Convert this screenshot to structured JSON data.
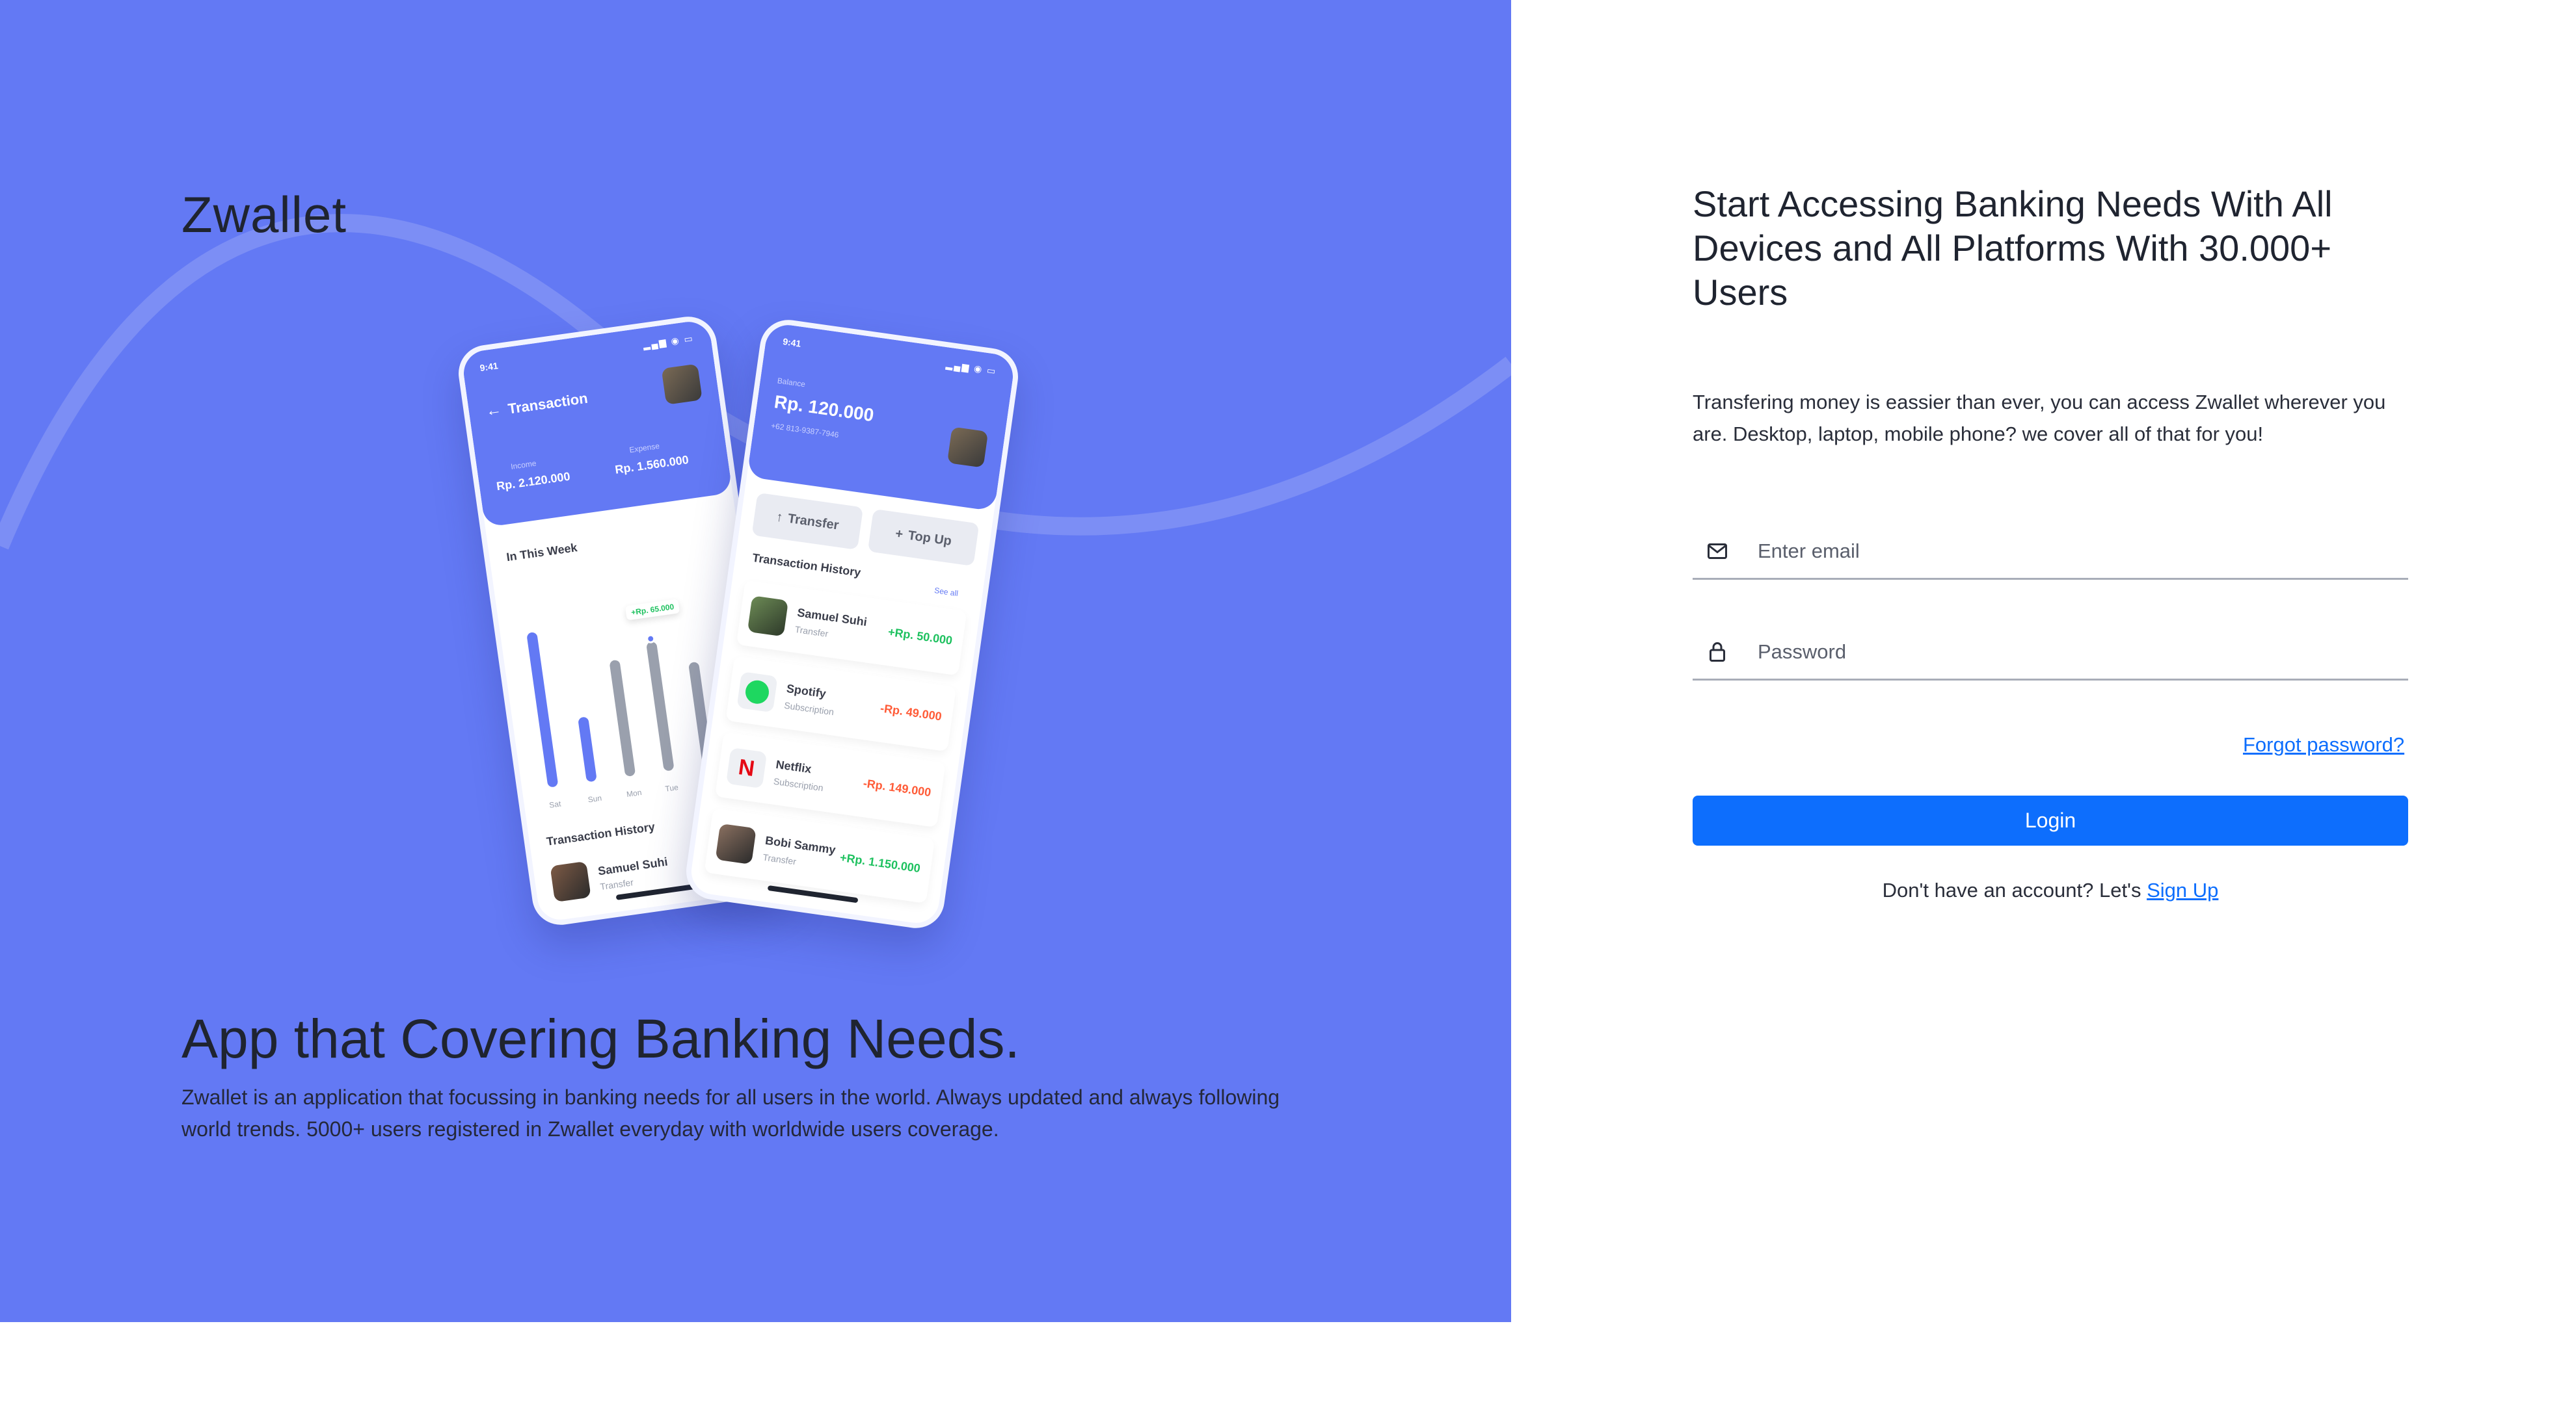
{
  "brand": "Zwallet",
  "hero": {
    "title": "App that Covering Banking Needs.",
    "description": "Zwallet is an application that focussing in banking needs for all users in the world. Always updated and always following world trends. 5000+ users registered in Zwallet everyday with worldwide users coverage."
  },
  "phone_a": {
    "time": "9:41",
    "title": "Transaction",
    "income_label": "Income",
    "income_value": "Rp. 2.120.000",
    "expense_label": "Expense",
    "expense_value": "Rp. 1.560.000",
    "week_label": "In This Week",
    "bubble": "+Rp. 65.000",
    "days": [
      "Sat",
      "Sun",
      "Mon",
      "Tue"
    ],
    "history_label": "Transaction History",
    "tx_name": "Samuel Suhi",
    "tx_type": "Transfer"
  },
  "phone_b": {
    "time": "9:41",
    "balance_label": "Balance",
    "balance_value": "Rp. 120.000",
    "phone_number": "+62 813-9387-7946",
    "transfer_label": "Transfer",
    "topup_label": "Top Up",
    "history_label": "Transaction History",
    "see_all": "See all",
    "transactions": [
      {
        "name": "Samuel Suhi",
        "type": "Transfer",
        "amount": "+Rp. 50.000"
      },
      {
        "name": "Spotify",
        "type": "Subscription",
        "amount": "-Rp. 49.000"
      },
      {
        "name": "Netflix",
        "type": "Subscription",
        "amount": "-Rp. 149.000"
      },
      {
        "name": "Bobi Sammy",
        "type": "Transfer",
        "amount": "+Rp. 1.150.000"
      }
    ]
  },
  "login": {
    "title": "Start Accessing Banking Needs With All Devices and All Platforms With 30.000+ Users",
    "description": "Transfering money is eassier than ever, you can access Zwallet wherever you are. Desktop, laptop, mobile phone? we cover all of that for you!",
    "email_placeholder": "Enter email",
    "password_placeholder": "Password",
    "forgot_label": "Forgot password?",
    "login_label": "Login",
    "signup_prompt": "Don't have an account? Let's ",
    "signup_label": "Sign Up"
  },
  "icons": {
    "email": "mail-icon",
    "password": "lock-icon"
  },
  "colors": {
    "brand_bg": "#6379f4",
    "primary": "#0d6efd",
    "income": "#1ec15f",
    "expense": "#ff5b37"
  }
}
